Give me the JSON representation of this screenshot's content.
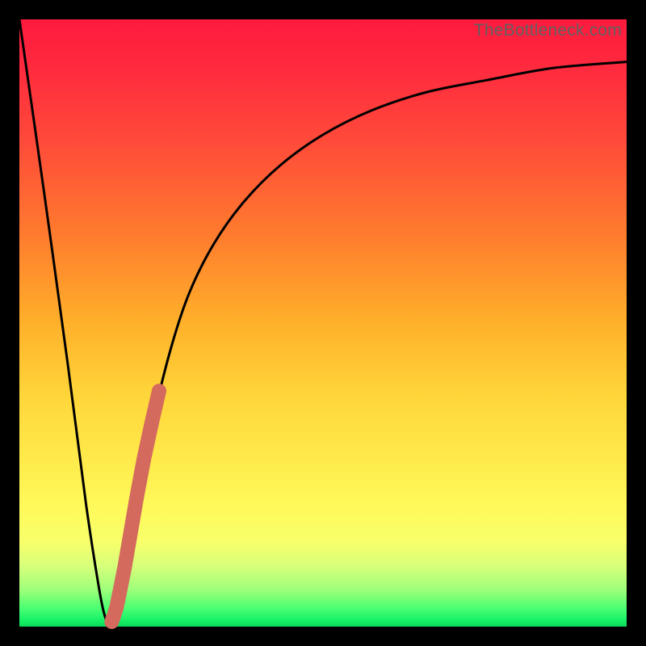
{
  "watermark": "TheBottleneck.com",
  "chart_data": {
    "type": "line",
    "title": "",
    "xlabel": "",
    "ylabel": "",
    "xlim": [
      0,
      100
    ],
    "ylim": [
      0,
      100
    ],
    "series": [
      {
        "name": "bottleneck-curve",
        "x": [
          0,
          4,
          8,
          11,
          13,
          14,
          15,
          16,
          17,
          18,
          20,
          22,
          25,
          28,
          32,
          37,
          43,
          50,
          58,
          67,
          77,
          88,
          100
        ],
        "values": [
          100,
          72,
          43,
          20,
          7,
          2,
          0,
          2,
          6,
          12,
          24,
          34,
          46,
          55,
          63,
          70,
          76,
          81,
          85,
          88,
          90,
          92,
          93
        ]
      },
      {
        "name": "highlight-segment",
        "x": [
          15.2,
          15.5,
          16.0,
          16.5,
          17.3,
          18.2,
          19.3,
          20.5,
          21.8,
          23.0
        ],
        "values": [
          0.8,
          1.6,
          3.2,
          5.6,
          9.6,
          14.8,
          21.2,
          27.6,
          33.6,
          38.8
        ]
      }
    ],
    "grid": false,
    "legend": false
  }
}
